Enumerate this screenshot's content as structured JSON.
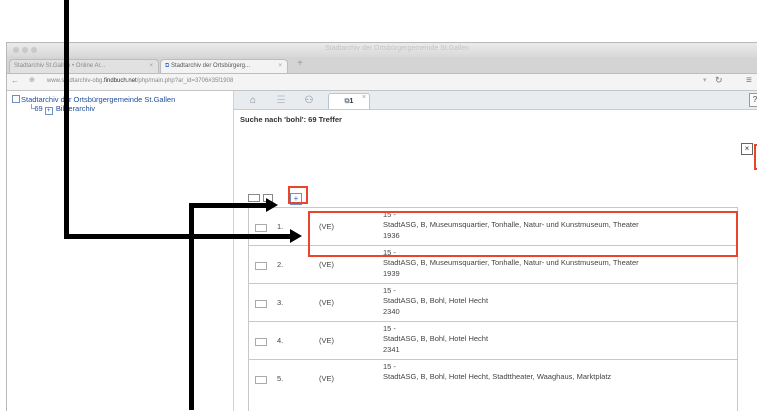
{
  "browser": {
    "window_title": "Stadtarchiv der Ortsbürgergemeinde St.Gallen",
    "tabs": [
      {
        "label": "Stadtarchiv St.Gallen • Online Ar..."
      },
      {
        "label": "Stadtarchiv der Ortsbürgerg..."
      }
    ],
    "url_host_prefix": "www.stadtarchiv-obg.",
    "url_host_bold": "findbuch.net",
    "url_path": "/php/main.php?ar_id=3706#35f1908"
  },
  "tree": {
    "root_label": "Stadtarchiv der Ortsbürgergemeinde St.Gallen",
    "child_count": "69",
    "child_label": "Bilderarchiv"
  },
  "content_tabs": {
    "result_tab_label": "1"
  },
  "search": {
    "heading": "Suche nach 'bohl': 69 Treffer"
  },
  "results": [
    {
      "num": "1.",
      "type": "(VE)",
      "line1": "15 -",
      "line2": "StadtASG, B,   Museumsquartier, Tonhalle, Natur- und Kunstmuseum, Theater",
      "line3": "1936"
    },
    {
      "num": "2.",
      "type": "(VE)",
      "line1": "15 -",
      "line2": "StadtASG, B,   Museumsquartier, Tonhalle, Natur- und Kunstmuseum, Theater",
      "line3": "1939"
    },
    {
      "num": "3.",
      "type": "(VE)",
      "line1": "15 -",
      "line2": "StadtASG, B,   Bohl, Hotel Hecht",
      "line3": "2340"
    },
    {
      "num": "4.",
      "type": "(VE)",
      "line1": "15 -",
      "line2": "StadtASG, B,   Bohl, Hotel Hecht",
      "line3": "2341"
    },
    {
      "num": "5.",
      "type": "(VE)",
      "line1": "15 -",
      "line2": "StadtASG, B,   Bohl, Hotel Hecht, Stadttheater, Waaghaus, Marktplatz",
      "line3": ""
    }
  ],
  "annotation_color": "#e8452b"
}
